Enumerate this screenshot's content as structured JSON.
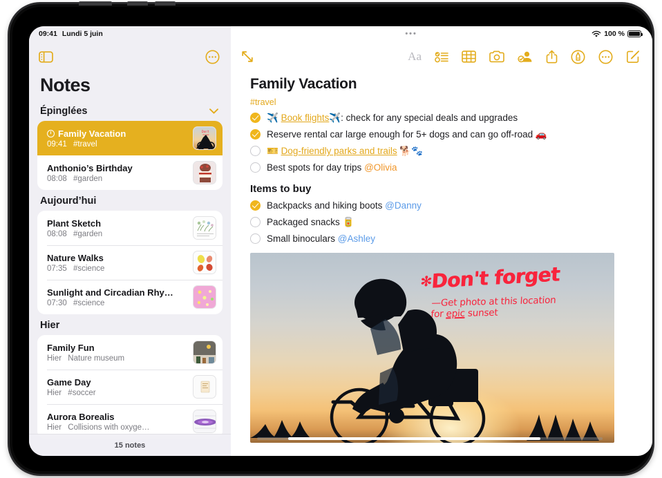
{
  "status_bar": {
    "time": "09:41",
    "date": "Lundi 5 juin",
    "center_handle": "•••",
    "wifi_icon": "wifi-icon",
    "battery_text": "100 %",
    "battery_icon": "battery-full-icon"
  },
  "sidebar": {
    "toolbar": {
      "sidebar_toggle_icon": "sidebar-toggle-icon",
      "more_icon": "more-circle-icon"
    },
    "title": "Notes",
    "footer_count": "15 notes",
    "groups": [
      {
        "header": "Épinglées",
        "collapse_icon": "chevron-down-icon",
        "notes": [
          {
            "title": "Family Vacation",
            "time": "09:41",
            "tag": "#travel",
            "selected": true,
            "pinned_icon": "clock-icon",
            "thumb": "cyclist-sunset-thumb"
          },
          {
            "title": "Anthonio’s Birthday",
            "time": "08:08",
            "tag": "#garden",
            "selected": false,
            "thumb": "cake-thumb"
          }
        ]
      },
      {
        "header": "Aujourd’hui",
        "notes": [
          {
            "title": "Plant Sketch",
            "time": "08:08",
            "tag": "#garden",
            "selected": false,
            "thumb": "plant-sketch-thumb"
          },
          {
            "title": "Nature Walks",
            "time": "07:35",
            "tag": "#science",
            "selected": false,
            "thumb": "leaves-thumb"
          },
          {
            "title": "Sunlight and Circadian Rhy…",
            "time": "07:30",
            "tag": "#science",
            "selected": false,
            "thumb": "pink-bloom-thumb"
          }
        ]
      },
      {
        "header": "Hier",
        "notes": [
          {
            "title": "Family Fun",
            "time": "Hier",
            "tag": "Nature museum",
            "selected": false,
            "thumb": "museum-thumb"
          },
          {
            "title": "Game Day",
            "time": "Hier",
            "tag": "#soccer",
            "selected": false,
            "thumb": "ticket-thumb"
          },
          {
            "title": "Aurora Borealis",
            "time": "Hier",
            "tag": "Collisions with oxyge…",
            "selected": false,
            "thumb": "aurora-thumb"
          }
        ]
      }
    ]
  },
  "detail": {
    "toolbar": {
      "expand_icon": "expand-diagonal-icon",
      "format_label": "Aa",
      "format_icon": "format-text-icon",
      "checklist_icon": "checklist-icon",
      "table_icon": "table-icon",
      "camera_icon": "camera-icon",
      "collaborate_icon": "add-person-icon",
      "share_icon": "share-icon",
      "markup_icon": "markup-pen-icon",
      "more_icon": "more-circle-icon",
      "compose_icon": "compose-icon"
    },
    "note_title": "Family Vacation",
    "tag": "#travel",
    "checklist": [
      {
        "done": true,
        "segments": [
          {
            "text": "✈️ ",
            "style": "emoji"
          },
          {
            "text": "Book flights",
            "style": "link"
          },
          {
            "text": "✈️",
            "style": "emoji"
          },
          {
            "text": ": check for any special deals and upgrades",
            "style": "plain"
          }
        ]
      },
      {
        "done": true,
        "segments": [
          {
            "text": "Reserve rental car large enough for 5+ dogs and can go off-road 🚗",
            "style": "plain"
          }
        ]
      },
      {
        "done": false,
        "segments": [
          {
            "text": "🎫 ",
            "style": "emoji"
          },
          {
            "text": "Dog-friendly parks and trails",
            "style": "link"
          },
          {
            "text": " 🐕🐾",
            "style": "emoji"
          }
        ]
      },
      {
        "done": false,
        "segments": [
          {
            "text": "Best spots for day trips ",
            "style": "plain"
          },
          {
            "text": "@Olivia",
            "style": "mention-orange"
          }
        ]
      }
    ],
    "section_heading": "Items to buy",
    "buy_list": [
      {
        "done": true,
        "segments": [
          {
            "text": "Backpacks and hiking boots ",
            "style": "plain"
          },
          {
            "text": "@Danny",
            "style": "mention-blue"
          }
        ]
      },
      {
        "done": false,
        "segments": [
          {
            "text": "Packaged snacks 🥫",
            "style": "plain"
          }
        ]
      },
      {
        "done": false,
        "segments": [
          {
            "text": "Small binoculars ",
            "style": "plain"
          },
          {
            "text": "@Ashley",
            "style": "mention-blue"
          }
        ]
      }
    ],
    "photo": {
      "name": "cyclist-sunset-photo",
      "annotation_heading": "Don't forget",
      "annotation_star": "✻",
      "annotation_line1_a": "—Get photo at this ",
      "annotation_line1_b": "location",
      "annotation_line2_a": "for ",
      "annotation_line2_underlined": "epic",
      "annotation_line2_b": " sunset",
      "ink_color": "#f8243c"
    }
  },
  "colors": {
    "accent": "#e3ac1c",
    "selected_row": "#e5b01f",
    "sidebar_bg": "#f0eff4",
    "mention_blue": "#5b9be8",
    "mention_orange": "#f0962a"
  }
}
